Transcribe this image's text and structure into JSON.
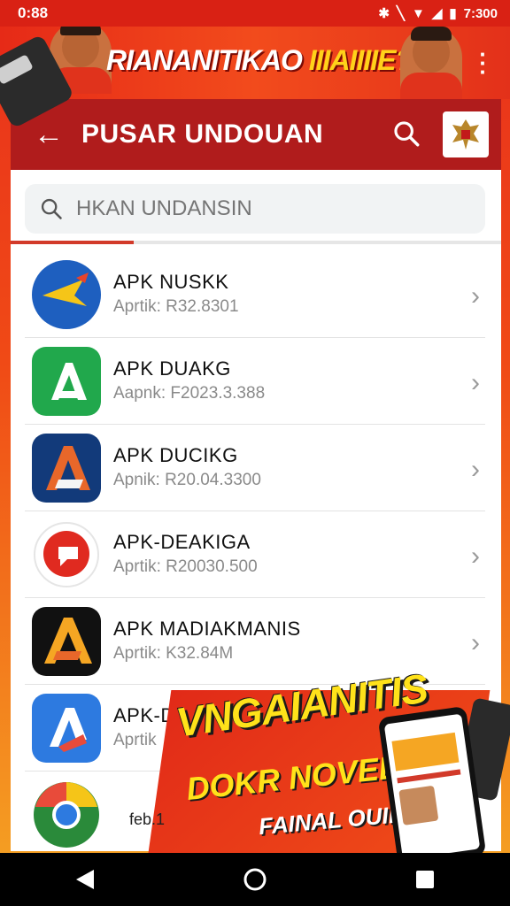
{
  "status_bar": {
    "time_left": "0:88",
    "time_right": "7:300"
  },
  "banner": {
    "title_part1": "RIANANITIKAO",
    "title_part2": "IIIAIIIIE?"
  },
  "toolbar": {
    "title": "PUSAR UNDOUAN"
  },
  "search": {
    "placeholder": "HKAN UNDANSIN"
  },
  "download_progress": 0.25,
  "apps": [
    {
      "name": "APK NUSKK",
      "meta": "Aprtik: R32.8301",
      "icon": "bird-logo-icon",
      "colors": [
        "#1e5fbf",
        "#f5a623"
      ]
    },
    {
      "name": "APK DUAKG",
      "meta": "Aapnk: F2023.3.388",
      "icon": "green-a-logo-icon",
      "colors": [
        "#21a84c",
        "#ffffff"
      ]
    },
    {
      "name": "APK DUCIKG",
      "meta": "Apnik: R20.04.3300",
      "icon": "navy-a-logo-icon",
      "colors": [
        "#123a7a",
        "#e8672a"
      ]
    },
    {
      "name": "APK-DEAKIGA",
      "meta": "Aprtik: R20030.500",
      "icon": "red-bubble-logo-icon",
      "colors": [
        "#ffffff",
        "#e02a20"
      ]
    },
    {
      "name": "APK MADIAKMANIS",
      "meta": "Aprtik: K32.84M",
      "icon": "orange-a-logo-icon",
      "colors": [
        "#111111",
        "#f5a623"
      ]
    },
    {
      "name": "APK-DROPE",
      "meta": "Aprtik",
      "icon": "blue-triangle-logo-icon",
      "colors": [
        "#2d7ae0",
        "#e84b3a"
      ]
    },
    {
      "name": "",
      "meta": "",
      "icon": "chrome-like-logo-icon",
      "colors": [
        "#f5c518",
        "#2a8a3a"
      ]
    }
  ],
  "promo": {
    "title": "VNGAIANITIS",
    "subtitle": "DOKR NOVEL!",
    "tagline": "FAINAL OUIR",
    "small": "feb.1"
  },
  "colors": {
    "toolbar": "#b01c1c",
    "status_bar": "#d92114",
    "accent": "#f5a623"
  }
}
